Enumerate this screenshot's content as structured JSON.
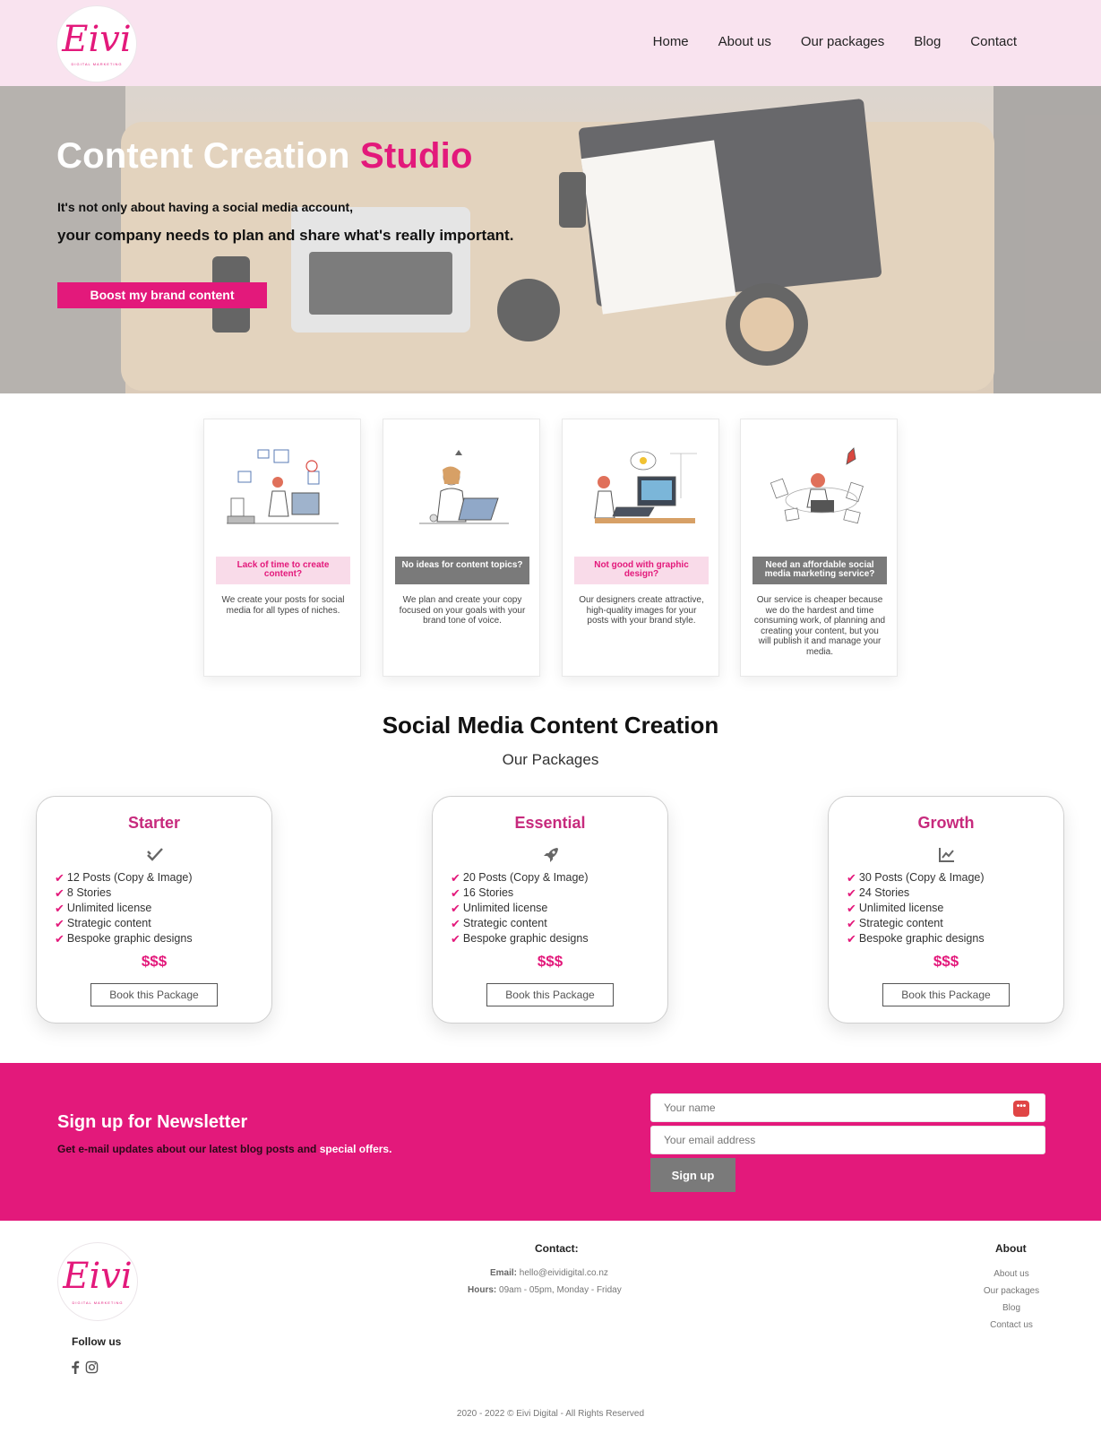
{
  "brand": {
    "logo_text": "Eivi",
    "logo_sub": "DIGITAL MARKETING",
    "color": "#e3197b"
  },
  "nav": [
    "Home",
    "About us",
    "Our packages",
    "Blog",
    "Contact"
  ],
  "hero": {
    "title_main": "Content Creation",
    "title_accent": "Studio",
    "line1": "It's not only about having a social media account,",
    "line2": "your company needs to plan and share what's really important.",
    "cta": "Boost my brand content"
  },
  "features": [
    {
      "title": "Lack of time to create content?",
      "style": "pink",
      "desc": "We create your posts for social media for all types of niches."
    },
    {
      "title": "No ideas for content topics?",
      "style": "grey",
      "desc": "We plan and create your copy focused on your goals with your brand tone of voice."
    },
    {
      "title": "Not good with graphic design?",
      "style": "pink",
      "desc": "Our designers create attractive, high-quality images for your posts with your brand style."
    },
    {
      "title": "Need an affordable social media marketing service?",
      "style": "grey",
      "desc": "Our service is cheaper because we do the hardest and time consuming work, of planning and creating your content, but you will publish it and manage your media."
    }
  ],
  "packages_section": {
    "title": "Social Media Content Creation",
    "subtitle": "Our Packages"
  },
  "packages": [
    {
      "name": "Starter",
      "icon": "double-check-icon",
      "items": [
        "12 Posts (Copy & Image)",
        "8 Stories",
        "Unlimited license",
        "Strategic content",
        "Bespoke graphic designs"
      ],
      "price": "$$$",
      "button": "Book this Package"
    },
    {
      "name": "Essential",
      "icon": "rocket-icon",
      "items": [
        "20 Posts (Copy & Image)",
        "16 Stories",
        "Unlimited license",
        "Strategic content",
        "Bespoke graphic designs"
      ],
      "price": "$$$",
      "button": "Book this Package"
    },
    {
      "name": "Growth",
      "icon": "chart-line-icon",
      "items": [
        "30 Posts (Copy & Image)",
        "24 Stories",
        "Unlimited license",
        "Strategic content",
        "Bespoke graphic designs"
      ],
      "price": "$$$",
      "button": "Book this Package"
    }
  ],
  "newsletter": {
    "title": "Sign up for Newsletter",
    "desc": "Get e-mail updates about our latest blog posts and",
    "desc_highlight": "special offers.",
    "name_placeholder": "Your name",
    "email_placeholder": "Your email address",
    "button": "Sign up",
    "badge": "•••"
  },
  "footer": {
    "follow": "Follow us",
    "social_icons": [
      "facebook-icon",
      "instagram-icon"
    ],
    "contact_heading": "Contact:",
    "email_label": "Email:",
    "email": "hello@eividigital.co.nz",
    "hours_label": "Hours:",
    "hours": "09am - 05pm, Monday - Friday",
    "about_heading": "About",
    "about_links": [
      "About us",
      "Our packages",
      "Blog",
      "Contact us"
    ],
    "copyright": "2020 - 2022 © Eivi Digital - All Rights Reserved"
  }
}
